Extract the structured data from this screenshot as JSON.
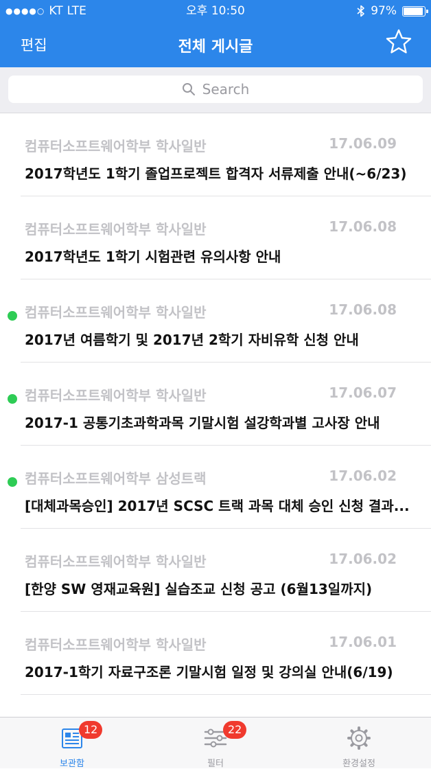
{
  "status_bar": {
    "carrier": "KT",
    "network": "LTE",
    "time": "오후 10:50",
    "battery": "97%"
  },
  "nav": {
    "edit_label": "편집",
    "title": "전체 게시글",
    "favorite_icon": "star-icon"
  },
  "search": {
    "placeholder": "Search"
  },
  "posts": [
    {
      "unread": false,
      "category": "컴퓨터소프트웨어학부 학사일반",
      "date": "17.06.09",
      "title": "2017학년도 1학기 졸업프로젝트 합격자 서류제출 안내(~6/23)"
    },
    {
      "unread": false,
      "category": "컴퓨터소프트웨어학부 학사일반",
      "date": "17.06.08",
      "title": "2017학년도 1학기 시험관련 유의사항 안내"
    },
    {
      "unread": true,
      "category": "컴퓨터소프트웨어학부 학사일반",
      "date": "17.06.08",
      "title": "2017년 여름학기 및 2017년 2학기 자비유학 신청 안내"
    },
    {
      "unread": true,
      "category": "컴퓨터소프트웨어학부 학사일반",
      "date": "17.06.07",
      "title": "2017-1 공통기초과학과목 기말시험 설강학과별 고사장 안내"
    },
    {
      "unread": true,
      "category": "컴퓨터소프트웨어학부 삼성트랙",
      "date": "17.06.02",
      "title": "[대체과목승인] 2017년 SCSC 트랙 과목 대체 승인 신청 결과..."
    },
    {
      "unread": false,
      "category": "컴퓨터소프트웨어학부 학사일반",
      "date": "17.06.02",
      "title": "[한양 SW 영재교육원] 실습조교 신청 공고 (6월13일까지)"
    },
    {
      "unread": false,
      "category": "컴퓨터소프트웨어학부 학사일반",
      "date": "17.06.01",
      "title": "2017-1학기 자료구조론 기말시험 일정 및 강의실 안내(6/19)"
    }
  ],
  "tabs": [
    {
      "label": "보관함",
      "badge": "12",
      "icon": "newspaper-icon",
      "active": true
    },
    {
      "label": "필터",
      "badge": "22",
      "icon": "sliders-icon",
      "active": false
    },
    {
      "label": "환경설정",
      "badge": "",
      "icon": "gear-icon",
      "active": false
    }
  ],
  "colors": {
    "accent": "#2c86ea",
    "unread_dot": "#2ecc55",
    "badge": "#f03a2e"
  }
}
